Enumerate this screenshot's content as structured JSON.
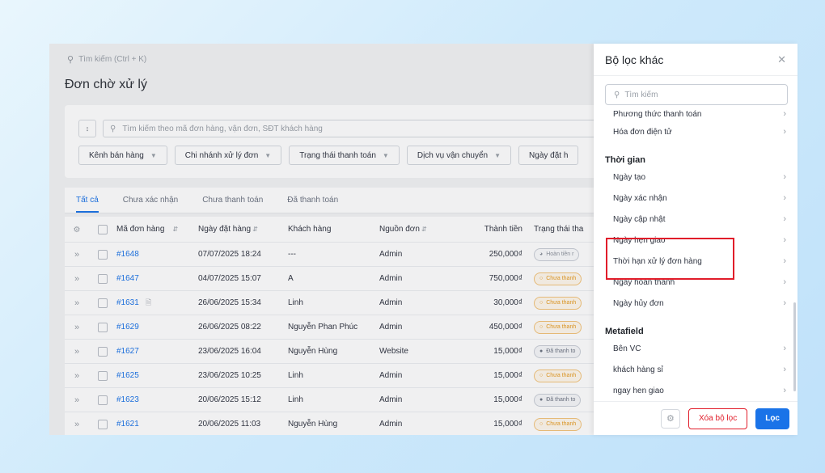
{
  "topbar": {
    "search_placeholder": "Tìm kiếm (Ctrl + K)"
  },
  "page": {
    "title": "Đơn chờ xử lý"
  },
  "filters": {
    "search_placeholder": "Tìm kiếm theo mã đơn hàng, vận đơn, SĐT khách hàng",
    "chips": [
      "Kênh bán hàng",
      "Chi nhánh xử lý đơn",
      "Trạng thái thanh toán",
      "Dịch vụ vận chuyển",
      "Ngày đặt h"
    ]
  },
  "tabs": [
    "Tất cả",
    "Chưa xác nhận",
    "Chưa thanh toán",
    "Đã thanh toán"
  ],
  "table": {
    "headers": {
      "code": "Mã đơn hàng",
      "date": "Ngày đặt hàng",
      "customer": "Khách hàng",
      "source": "Nguồn đơn",
      "amount": "Thành tiền",
      "payment": "Trạng thái tha"
    },
    "rows": [
      {
        "code": "#1648",
        "date": "07/07/2025 18:24",
        "customer": "---",
        "source": "Admin",
        "amount": "250,000₫",
        "status": "Hoàn tiền r",
        "kind": "refund"
      },
      {
        "code": "#1647",
        "date": "04/07/2025 15:07",
        "customer": "A",
        "source": "Admin",
        "amount": "750,000₫",
        "status": "Chưa thanh",
        "kind": "pending"
      },
      {
        "code": "#1631",
        "date": "26/06/2025 15:34",
        "customer": "Linh",
        "source": "Admin",
        "amount": "30,000₫",
        "status": "Chưa thanh",
        "kind": "pending"
      },
      {
        "code": "#1629",
        "date": "26/06/2025 08:22",
        "customer": "Nguyễn Phan Phúc",
        "source": "Admin",
        "amount": "450,000₫",
        "status": "Chưa thanh",
        "kind": "pending"
      },
      {
        "code": "#1627",
        "date": "23/06/2025 16:04",
        "customer": "Nguyễn Hùng",
        "source": "Website",
        "amount": "15,000₫",
        "status": "Đã thanh to",
        "kind": "paid"
      },
      {
        "code": "#1625",
        "date": "23/06/2025 10:25",
        "customer": "Linh",
        "source": "Admin",
        "amount": "15,000₫",
        "status": "Chưa thanh",
        "kind": "pending"
      },
      {
        "code": "#1623",
        "date": "20/06/2025 15:12",
        "customer": "Linh",
        "source": "Admin",
        "amount": "15,000₫",
        "status": "Đã thanh to",
        "kind": "paid"
      },
      {
        "code": "#1621",
        "date": "20/06/2025 11:03",
        "customer": "Nguyễn Hùng",
        "source": "Admin",
        "amount": "15,000₫",
        "status": "Chưa thanh",
        "kind": "pending"
      }
    ]
  },
  "drawer": {
    "title": "Bộ lọc khác",
    "search_placeholder": "Tìm kiếm",
    "cut_item": "Phương thức thanh toán",
    "top_items": [
      "Hóa đơn điện tử"
    ],
    "section_time": "Thời gian",
    "time_items": [
      "Ngày tạo",
      "Ngày xác nhận",
      "Ngày cập nhật",
      "Ngày hẹn giao",
      "Thời hạn xử lý đơn hàng",
      "Ngày hoàn thành",
      "Ngày hủy đơn"
    ],
    "section_meta": "Metafield",
    "meta_items": [
      "Bên VC",
      "khách hàng sỉ",
      "ngay hen giao"
    ],
    "clear_label": "Xóa bộ lọc",
    "apply_label": "Lọc"
  },
  "colors": {
    "accent": "#1a73e8",
    "danger": "#e11d2a",
    "pending": "#e79a1d"
  }
}
